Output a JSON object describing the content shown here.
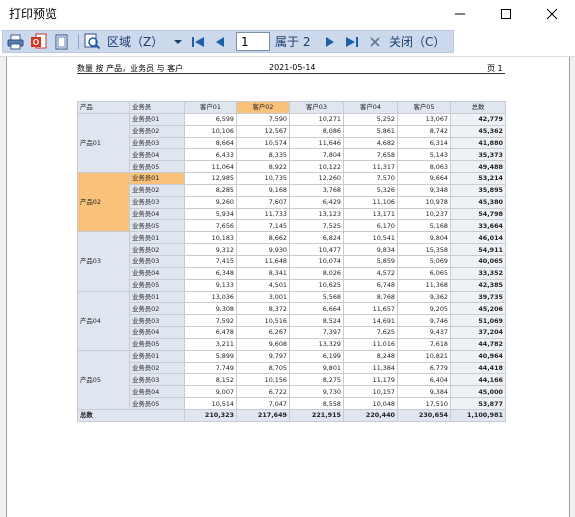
{
  "window": {
    "title": "打印预览"
  },
  "toolbar": {
    "region_label": "区域（Z）",
    "page_value": "1",
    "page_of": "属于 2",
    "close_label": "关闭（C）"
  },
  "page_header": {
    "left": "数量 按 产品，业务员 与 客户",
    "center": "2021-05-14",
    "right": "页 1"
  },
  "table": {
    "corner1": "产品",
    "corner2": "业务员",
    "columns": [
      "客户01",
      "客户02",
      "客户03",
      "客户04",
      "客户05"
    ],
    "total_label": "总数",
    "selected_column": 1,
    "selected_group": 1,
    "groups": [
      {
        "product": "产品01",
        "rows": [
          {
            "rep": "业务员01",
            "values": [
              "6,599",
              "7,590",
              "10,271",
              "5,252",
              "13,067"
            ],
            "total": "42,779"
          },
          {
            "rep": "业务员02",
            "values": [
              "10,106",
              "12,567",
              "8,086",
              "5,861",
              "8,742"
            ],
            "total": "45,362"
          },
          {
            "rep": "业务员03",
            "values": [
              "8,664",
              "10,574",
              "11,646",
              "4,682",
              "6,314"
            ],
            "total": "41,880"
          },
          {
            "rep": "业务员04",
            "values": [
              "6,433",
              "8,335",
              "7,804",
              "7,658",
              "5,143"
            ],
            "total": "35,373"
          },
          {
            "rep": "业务员05",
            "values": [
              "11,064",
              "8,922",
              "10,122",
              "11,317",
              "8,063"
            ],
            "total": "49,488"
          }
        ]
      },
      {
        "product": "产品02",
        "rows": [
          {
            "rep": "业务员01",
            "values": [
              "12,985",
              "10,735",
              "12,260",
              "7,570",
              "9,664"
            ],
            "total": "53,214"
          },
          {
            "rep": "业务员02",
            "values": [
              "8,285",
              "9,168",
              "3,768",
              "5,326",
              "9,348"
            ],
            "total": "35,895"
          },
          {
            "rep": "业务员03",
            "values": [
              "9,260",
              "7,607",
              "6,429",
              "11,106",
              "10,978"
            ],
            "total": "45,380"
          },
          {
            "rep": "业务员04",
            "values": [
              "5,934",
              "11,733",
              "13,123",
              "13,171",
              "10,237"
            ],
            "total": "54,798"
          },
          {
            "rep": "业务员05",
            "values": [
              "7,656",
              "7,145",
              "7,525",
              "6,170",
              "5,168"
            ],
            "total": "33,664"
          }
        ]
      },
      {
        "product": "产品03",
        "rows": [
          {
            "rep": "业务员01",
            "values": [
              "10,183",
              "8,662",
              "6,824",
              "10,541",
              "9,804"
            ],
            "total": "46,014"
          },
          {
            "rep": "业务员02",
            "values": [
              "9,312",
              "9,930",
              "10,477",
              "9,834",
              "15,358"
            ],
            "total": "54,911"
          },
          {
            "rep": "业务员03",
            "values": [
              "7,415",
              "11,648",
              "10,074",
              "5,859",
              "5,069"
            ],
            "total": "40,065"
          },
          {
            "rep": "业务员04",
            "values": [
              "6,348",
              "8,341",
              "8,026",
              "4,572",
              "6,065"
            ],
            "total": "33,352"
          },
          {
            "rep": "业务员05",
            "values": [
              "9,133",
              "4,501",
              "10,625",
              "6,748",
              "11,368"
            ],
            "total": "42,385"
          }
        ]
      },
      {
        "product": "产品04",
        "rows": [
          {
            "rep": "业务员01",
            "values": [
              "13,036",
              "3,001",
              "5,568",
              "8,768",
              "9,362"
            ],
            "total": "39,735"
          },
          {
            "rep": "业务员02",
            "values": [
              "9,308",
              "8,372",
              "6,664",
              "11,657",
              "9,205"
            ],
            "total": "45,206"
          },
          {
            "rep": "业务员03",
            "values": [
              "7,592",
              "10,516",
              "8,524",
              "14,691",
              "9,746"
            ],
            "total": "51,069"
          },
          {
            "rep": "业务员04",
            "values": [
              "6,478",
              "6,267",
              "7,397",
              "7,625",
              "9,437"
            ],
            "total": "37,204"
          },
          {
            "rep": "业务员05",
            "values": [
              "3,211",
              "9,608",
              "13,329",
              "11,016",
              "7,618"
            ],
            "total": "44,782"
          }
        ]
      },
      {
        "product": "产品05",
        "rows": [
          {
            "rep": "业务员01",
            "values": [
              "5,899",
              "9,797",
              "6,199",
              "8,248",
              "10,821"
            ],
            "total": "40,964"
          },
          {
            "rep": "业务员02",
            "values": [
              "7,749",
              "8,705",
              "9,801",
              "11,384",
              "6,779"
            ],
            "total": "44,418"
          },
          {
            "rep": "业务员03",
            "values": [
              "8,152",
              "10,156",
              "8,275",
              "11,179",
              "6,404"
            ],
            "total": "44,166"
          },
          {
            "rep": "业务员04",
            "values": [
              "9,007",
              "6,722",
              "9,730",
              "10,157",
              "9,384"
            ],
            "total": "45,000"
          },
          {
            "rep": "业务员05",
            "values": [
              "10,514",
              "7,047",
              "8,558",
              "10,048",
              "17,510"
            ],
            "total": "53,877"
          }
        ]
      }
    ],
    "grand": {
      "label": "总数",
      "values": [
        "210,323",
        "217,649",
        "221,915",
        "220,440",
        "230,654"
      ],
      "total": "1,100,981"
    }
  },
  "colors": {
    "toolbar_bg": "#ccd9ec",
    "header_bg": "#dfe6f0",
    "selection": "#f9c27a",
    "icon_blue": "#1f5fa8"
  },
  "icons": [
    "print-icon",
    "export-office-icon",
    "page-setup-icon",
    "zoom-icon",
    "first-page-icon",
    "prev-page-icon",
    "next-page-icon",
    "last-page-icon",
    "close-x-icon"
  ]
}
